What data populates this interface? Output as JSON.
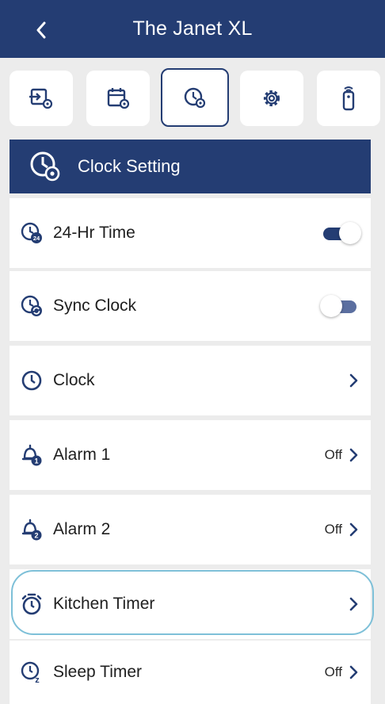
{
  "header": {
    "title": "The Janet XL"
  },
  "toolbar": {
    "buttons": [
      {
        "icon": "input-settings-icon",
        "active": false
      },
      {
        "icon": "calendar-settings-icon",
        "active": false
      },
      {
        "icon": "clock-settings-icon",
        "active": true
      },
      {
        "icon": "gear-icon",
        "active": false
      },
      {
        "icon": "remote-control-icon",
        "active": false
      }
    ]
  },
  "section": {
    "title": "Clock Setting"
  },
  "rows": [
    {
      "label": "24-Hr Time",
      "icon": "clock-24-icon",
      "control": "toggle",
      "on": true
    },
    {
      "label": "Sync Clock",
      "icon": "clock-sync-icon",
      "control": "toggle",
      "on": false
    },
    {
      "label": "Clock",
      "icon": "clock-icon",
      "control": "chevron",
      "status": ""
    },
    {
      "label": "Alarm 1",
      "icon": "alarm-1-icon",
      "control": "chevron",
      "status": "Off"
    },
    {
      "label": "Alarm 2",
      "icon": "alarm-2-icon",
      "control": "chevron",
      "status": "Off"
    },
    {
      "label": "Kitchen Timer",
      "icon": "stopwatch-icon",
      "control": "chevron",
      "status": ""
    },
    {
      "label": "Sleep Timer",
      "icon": "sleep-timer-icon",
      "control": "chevron",
      "status": "Off"
    }
  ],
  "colors": {
    "primary": "#243d73",
    "toggle_on_track": "#243d73",
    "toggle_off_track": "#5b6fa0",
    "highlight": "#7ec0d8",
    "background": "#ececec"
  }
}
